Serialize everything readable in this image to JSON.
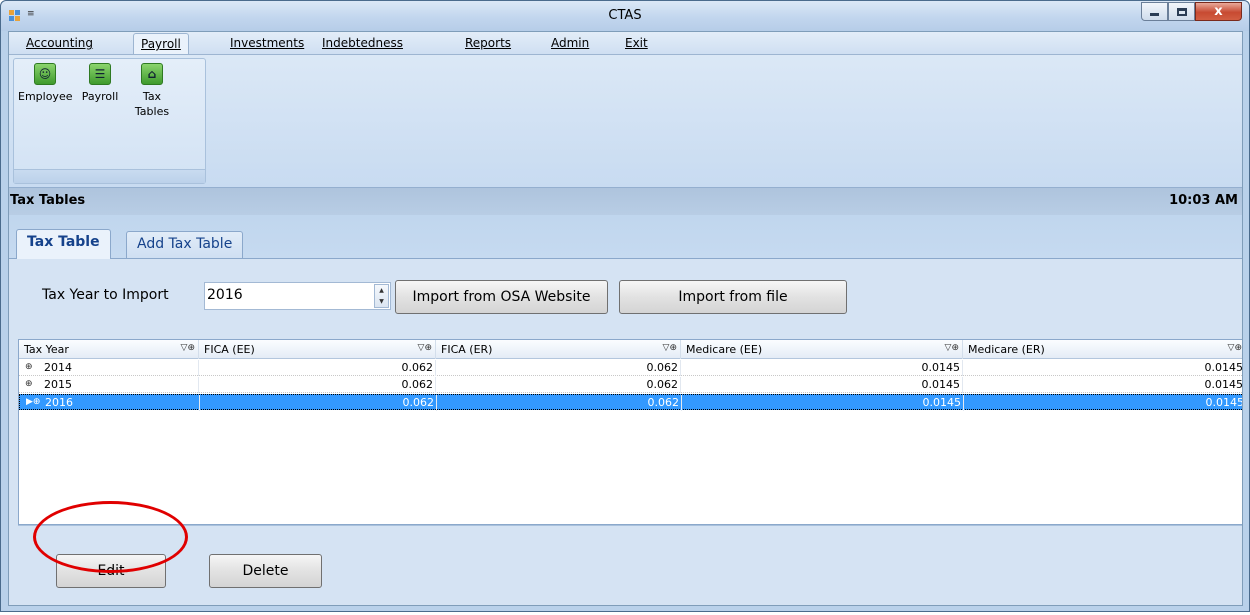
{
  "window": {
    "title": "CTAS",
    "qat_symbol": "≡"
  },
  "menu": {
    "items": [
      {
        "label": "Accounting"
      },
      {
        "label": "Payroll"
      },
      {
        "label": "Investments"
      },
      {
        "label": "Indebtedness"
      },
      {
        "label": "Reports"
      },
      {
        "label": "Admin"
      },
      {
        "label": "Exit"
      }
    ],
    "active": "Payroll"
  },
  "ribbon": {
    "buttons": [
      {
        "label": "Employee",
        "icon": "employee-icon",
        "glyph": "☺"
      },
      {
        "label": "Payroll",
        "icon": "payroll-icon",
        "glyph": "☰"
      },
      {
        "label": "Tax\nTables",
        "icon": "tax-tables-icon",
        "glyph": "⌂"
      }
    ]
  },
  "section": {
    "title": "Tax Tables",
    "time": "10:03 AM"
  },
  "tabs": [
    {
      "label": "Tax Table",
      "active": true
    },
    {
      "label": "Add Tax Table",
      "active": false
    }
  ],
  "import": {
    "label": "Tax Year to Import",
    "year_value": "2016",
    "osa_button": "Import from OSA Website",
    "file_button": "Import from file"
  },
  "grid": {
    "columns": [
      "Tax Year",
      "FICA (EE)",
      "FICA (ER)",
      "Medicare (EE)",
      "Medicare (ER)"
    ],
    "header_tools": "▽⊕",
    "rows": [
      {
        "tax_year": "2014",
        "fica_ee": "0.062",
        "fica_er": "0.062",
        "medicare_ee": "0.0145",
        "medicare_er": "0.0145",
        "selected": false
      },
      {
        "tax_year": "2015",
        "fica_ee": "0.062",
        "fica_er": "0.062",
        "medicare_ee": "0.0145",
        "medicare_er": "0.0145",
        "selected": false
      },
      {
        "tax_year": "2016",
        "fica_ee": "0.062",
        "fica_er": "0.062",
        "medicare_ee": "0.0145",
        "medicare_er": "0.0145",
        "selected": true
      }
    ]
  },
  "actions": {
    "edit": "Edit",
    "delete": "Delete"
  },
  "colors": {
    "selection": "#3399ff",
    "annotation": "#e00000",
    "ribbon_icon": "#4caf3a"
  }
}
